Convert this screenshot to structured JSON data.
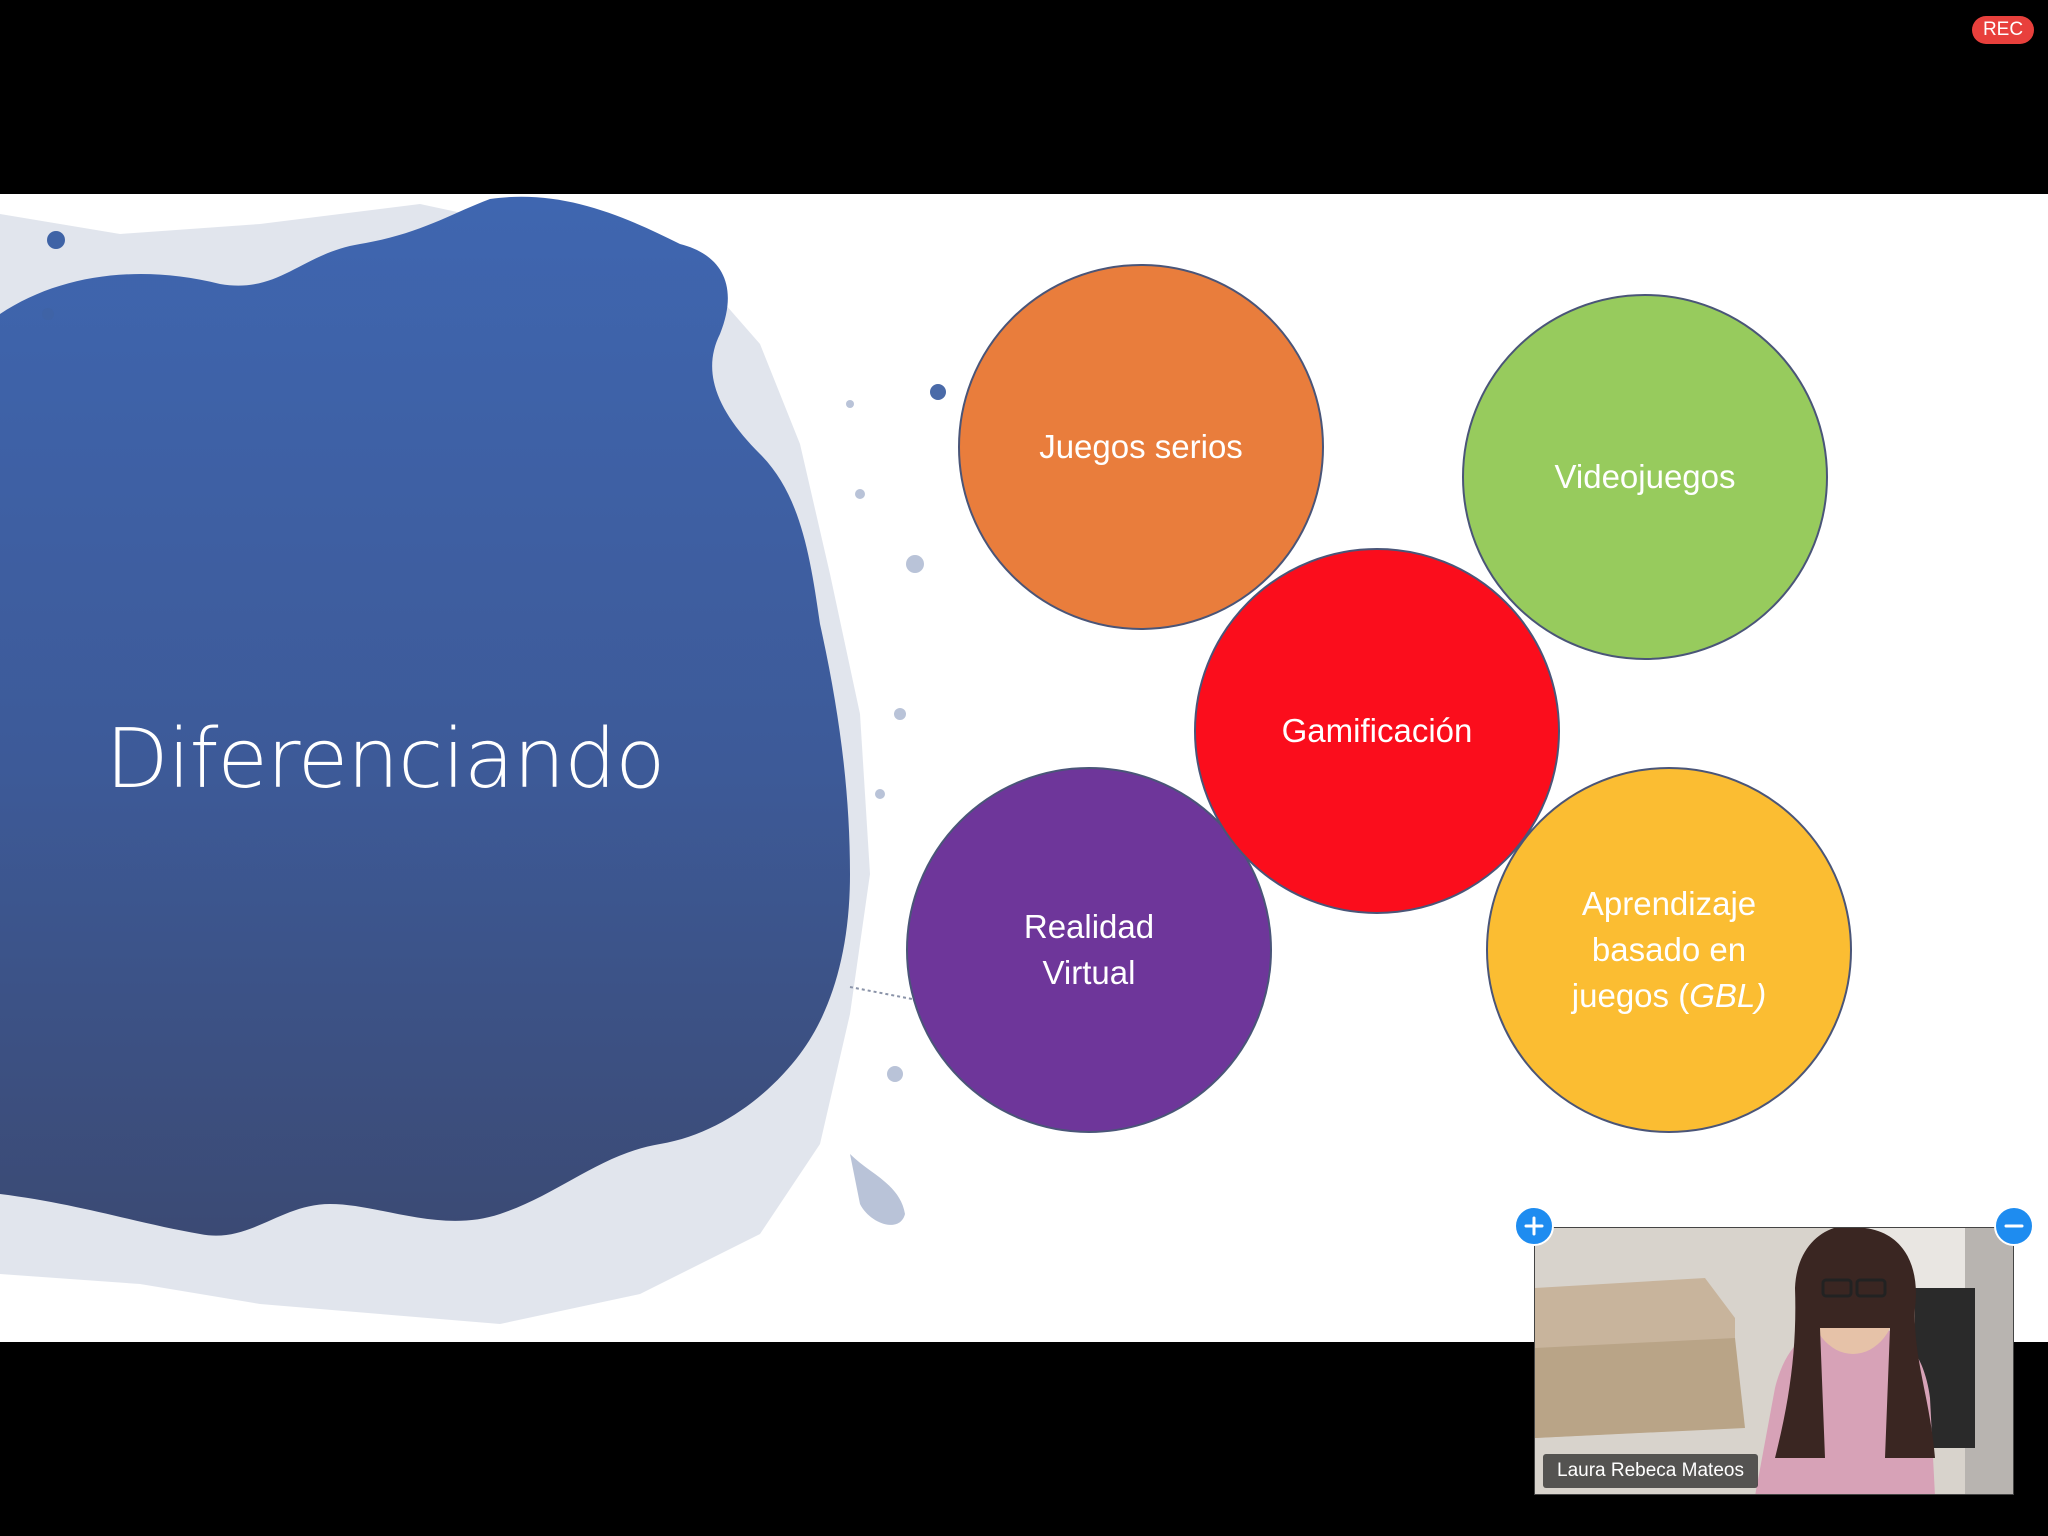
{
  "recording": {
    "label": "REC",
    "color": "#e8403c"
  },
  "slide": {
    "title": "Diferenciando",
    "bubbles": {
      "juegos_serios": {
        "label": "Juegos serios",
        "color": "#e97d3c"
      },
      "videojuegos": {
        "label": "Videojuegos",
        "color": "#97cb5d"
      },
      "gamificacion": {
        "label": "Gamificación",
        "color": "#fb0d1c"
      },
      "realidad_virtual": {
        "line1": "Realidad",
        "line2": "Virtual",
        "color": "#6e369a"
      },
      "gbl": {
        "line1": "Aprendizaje",
        "line2": "basado en",
        "line3_prefix": "juegos (",
        "line3_italic": "GBL)",
        "color": "#fbbd32"
      }
    },
    "splash_color": "#3f63a6"
  },
  "controls": {
    "zoom_in_icon": "plus-icon",
    "zoom_out_icon": "minus-icon",
    "accent": "#1e8cf0"
  },
  "participant": {
    "name": "Laura Rebeca Mateos"
  }
}
